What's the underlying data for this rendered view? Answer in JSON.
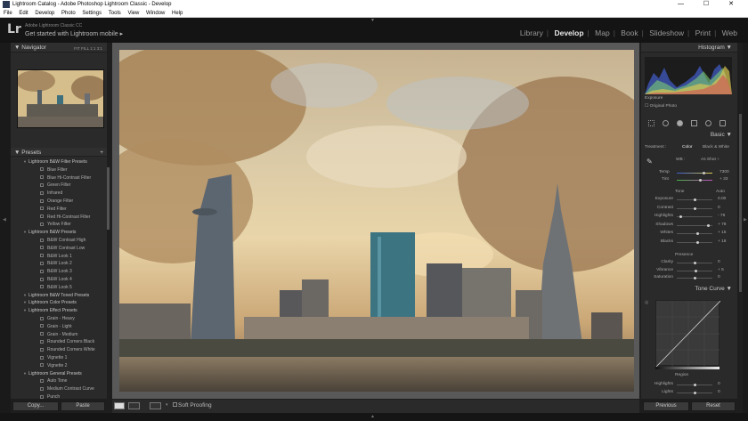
{
  "window": {
    "title": "Lightroom Catalog - Adobe Photoshop Lightroom Classic - Develop",
    "controls": [
      "—",
      "☐",
      "✕"
    ]
  },
  "menu": [
    "File",
    "Edit",
    "Develop",
    "Photo",
    "Settings",
    "Tools",
    "View",
    "Window",
    "Help"
  ],
  "identity": {
    "logo": "Lr",
    "product": "Adobe Lightroom Classic CC",
    "tagline": "Get started with Lightroom mobile ▸"
  },
  "modules": [
    "Library",
    "Develop",
    "Map",
    "Book",
    "Slideshow",
    "Print",
    "Web"
  ],
  "active_module": "Develop",
  "navigator": {
    "title": "Navigator",
    "zoom_options": [
      "FIT",
      "FILL",
      "1:1",
      "3:1"
    ]
  },
  "presets": {
    "title": "Presets",
    "add": "+",
    "items": [
      {
        "type": "group",
        "label": "Lightroom B&W Filter Presets"
      },
      {
        "type": "item",
        "label": "Blue Filter"
      },
      {
        "type": "item",
        "label": "Blue Hi-Contrast Filter"
      },
      {
        "type": "item",
        "label": "Green Filter"
      },
      {
        "type": "item",
        "label": "Infrared"
      },
      {
        "type": "item",
        "label": "Orange Filter"
      },
      {
        "type": "item",
        "label": "Red Filter"
      },
      {
        "type": "item",
        "label": "Red Hi-Contrast Filter"
      },
      {
        "type": "item",
        "label": "Yellow Filter"
      },
      {
        "type": "group",
        "label": "Lightroom B&W Presets"
      },
      {
        "type": "item",
        "label": "B&W Contrast High"
      },
      {
        "type": "item",
        "label": "B&W Contrast Low"
      },
      {
        "type": "item",
        "label": "B&W Look 1"
      },
      {
        "type": "item",
        "label": "B&W Look 2"
      },
      {
        "type": "item",
        "label": "B&W Look 3"
      },
      {
        "type": "item",
        "label": "B&W Look 4"
      },
      {
        "type": "item",
        "label": "B&W Look 5"
      },
      {
        "type": "group",
        "label": "Lightroom B&W Toned Presets"
      },
      {
        "type": "group",
        "label": "Lightroom Color Presets"
      },
      {
        "type": "group",
        "label": "Lightroom Effect Presets"
      },
      {
        "type": "item",
        "label": "Grain - Heavy"
      },
      {
        "type": "item",
        "label": "Grain - Light"
      },
      {
        "type": "item",
        "label": "Grain - Medium"
      },
      {
        "type": "item",
        "label": "Rounded Corners Black"
      },
      {
        "type": "item",
        "label": "Rounded Corners White"
      },
      {
        "type": "item",
        "label": "Vignette 1"
      },
      {
        "type": "item",
        "label": "Vignette 2"
      },
      {
        "type": "group",
        "label": "Lightroom General Presets"
      },
      {
        "type": "item",
        "label": "Auto Tone"
      },
      {
        "type": "item",
        "label": "Medium Contrast Curve"
      },
      {
        "type": "item",
        "label": "Punch"
      }
    ]
  },
  "left_buttons": {
    "copy": "Copy...",
    "paste": "Paste"
  },
  "toolbar": {
    "soft_proofing": "Soft Proofing"
  },
  "histogram": {
    "title": "Histogram",
    "exposure_label": "Exposure",
    "original_photo": "Original Photo"
  },
  "basic": {
    "title": "Basic",
    "treatment_label": "Treatment :",
    "treatment_options": [
      "Color",
      "Black & White"
    ],
    "wb_label": "WB :",
    "wb_value": "As Shot ÷",
    "temp_label": "Temp",
    "temp_value": "7300",
    "tint_label": "Tint",
    "tint_value": "+ 33",
    "tone_label": "Tone",
    "auto_label": "Auto",
    "sliders": [
      {
        "label": "Exposure",
        "value": "0.00",
        "level": 0.5
      },
      {
        "label": "Contrast",
        "value": "0",
        "level": 0.5
      },
      {
        "label": "Highlights",
        "value": "- 76",
        "level": 0.12
      },
      {
        "label": "Shadows",
        "value": "+ 78",
        "level": 0.89
      },
      {
        "label": "Whites",
        "value": "+ 15",
        "level": 0.575
      },
      {
        "label": "Blacks",
        "value": "+ 18",
        "level": 0.59
      }
    ],
    "presence_label": "Presence",
    "presence_sliders": [
      {
        "label": "Clarity",
        "value": "0",
        "level": 0.5
      },
      {
        "label": "Vibrance",
        "value": "+ 5",
        "level": 0.525
      },
      {
        "label": "Saturation",
        "value": "0",
        "level": 0.5
      }
    ]
  },
  "tone_curve": {
    "title": "Tone Curve",
    "region_label": "Region",
    "region_sliders": [
      {
        "label": "Highlights",
        "value": "0",
        "level": 0.5
      },
      {
        "label": "Lights",
        "value": "0",
        "level": 0.5
      }
    ]
  },
  "right_buttons": {
    "previous": "Previous",
    "reset": "Reset"
  },
  "colors": {
    "accent": "#e8e8e8",
    "panel": "#2a2a2a",
    "canvas": "#595959"
  }
}
